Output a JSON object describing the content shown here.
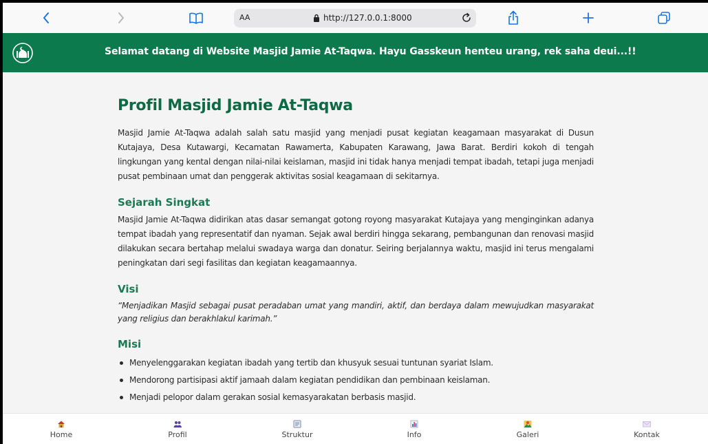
{
  "browser": {
    "text_size_label": "AA",
    "url": "http://127.0.0.1:8000"
  },
  "header": {
    "welcome": "Selamat datang di Website Masjid Jamie At-Taqwa. Hayu Gasskeun henteu urang, rek saha deui...!!"
  },
  "main": {
    "title": "Profil Masjid Jamie At-Taqwa",
    "intro": "Masjid Jamie At-Taqwa adalah salah satu masjid yang menjadi pusat kegiatan keagamaan masyarakat di Dusun Kutajaya, Desa Kutawargi, Kecamatan Rawamerta, Kabupaten Karawang, Jawa Barat. Berdiri kokoh di tengah lingkungan yang kental dengan nilai-nilai keislaman, masjid ini tidak hanya menjadi tempat ibadah, tetapi juga menjadi pusat pembinaan umat dan penggerak aktivitas sosial keagamaan di sekitarnya.",
    "sejarah_heading": "Sejarah Singkat",
    "sejarah_text": "Masjid Jamie At-Taqwa didirikan atas dasar semangat gotong royong masyarakat Kutajaya yang menginginkan adanya tempat ibadah yang representatif dan nyaman. Sejak awal berdiri hingga sekarang, pembangunan dan renovasi masjid dilakukan secara bertahap melalui swadaya warga dan donatur. Seiring berjalannya waktu, masjid ini terus mengalami peningkatan dari segi fasilitas dan kegiatan keagamaannya.",
    "visi_heading": "Visi",
    "visi_text": "“Menjadikan Masjid sebagai pusat peradaban umat yang mandiri, aktif, dan berdaya dalam mewujudkan masyarakat yang religius dan berakhlakul karimah.”",
    "misi_heading": "Misi",
    "misi_items": [
      "Menyelenggarakan kegiatan ibadah yang tertib dan khusyuk sesuai tuntunan syariat Islam.",
      "Mendorong partisipasi aktif jamaah dalam kegiatan pendidikan dan pembinaan keislaman.",
      "Menjadi pelopor dalam gerakan sosial kemasyarakatan berbasis masjid."
    ]
  },
  "bottom_nav": [
    {
      "label": "Home",
      "icon": "house-icon",
      "color": "#c0392b"
    },
    {
      "label": "Profil",
      "icon": "people-icon",
      "color": "#5b3fa0"
    },
    {
      "label": "Struktur",
      "icon": "document-icon",
      "color": "#7a8aa6"
    },
    {
      "label": "Info",
      "icon": "chart-icon",
      "color": "#3a74c8"
    },
    {
      "label": "Galeri",
      "icon": "picture-icon",
      "color": "#2e8b57"
    },
    {
      "label": "Kontak",
      "icon": "envelope-icon",
      "color": "#c9b3e0"
    }
  ],
  "colors": {
    "header_green": "#0d7a4e",
    "title_green": "#0d6a45",
    "safari_blue": "#1a73e8"
  }
}
